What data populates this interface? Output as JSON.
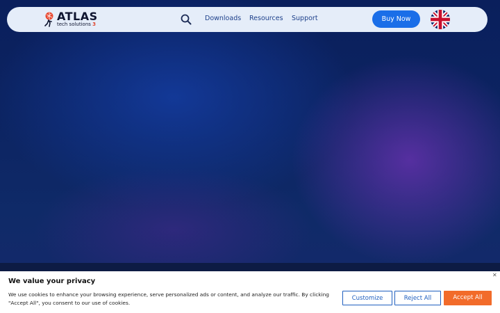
{
  "nav": {
    "logo": {
      "word": "ATLAS",
      "tagline": "tech solutions",
      "tagline_suffix": "3"
    },
    "links": [
      "Downloads",
      "Resources",
      "Support"
    ],
    "buy_label": "Buy Now",
    "language_icon": "uk-flag-icon",
    "search_icon": "search-icon"
  },
  "cookie": {
    "title": "We value your privacy",
    "text": "We use cookies to enhance your browsing experience, serve personalized ads or content, and analyze our traffic. By clicking \"Accept All\", you consent to our use of cookies.",
    "close_glyph": "✕",
    "customize_label": "Customize",
    "reject_label": "Reject All",
    "accept_label": "Accept All"
  },
  "colors": {
    "nav_bg": "#e5edf9",
    "nav_link": "#1c3f8a",
    "primary": "#1a6ee8",
    "accept": "#f26b2a",
    "outline": "#1f5fbf",
    "hero_blue": "#0c2462",
    "hero_purple": "#6e32b4"
  }
}
